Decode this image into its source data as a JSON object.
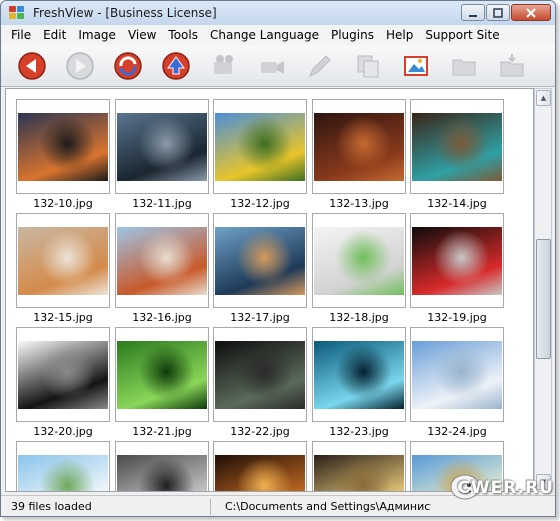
{
  "window": {
    "title": "FreshView - [Business License]"
  },
  "menu": [
    "File",
    "Edit",
    "Image",
    "View",
    "Tools",
    "Change Language",
    "Plugins",
    "Help",
    "Support Site"
  ],
  "toolbar": {
    "buttons": [
      {
        "icon": "back-arrow-icon",
        "enabled": true
      },
      {
        "icon": "forward-arrow-icon",
        "enabled": false
      },
      {
        "icon": "refresh-icon",
        "enabled": true
      },
      {
        "icon": "up-arrow-icon",
        "enabled": true
      },
      {
        "icon": "slideshow-projector-icon",
        "enabled": false
      },
      {
        "icon": "video-camera-icon",
        "enabled": false
      },
      {
        "icon": "pen-edit-icon",
        "enabled": false
      },
      {
        "icon": "copy-files-icon",
        "enabled": false
      },
      {
        "icon": "image-edit-icon",
        "enabled": true
      },
      {
        "icon": "folder-icon",
        "enabled": false
      },
      {
        "icon": "save-folder-icon",
        "enabled": false
      }
    ]
  },
  "thumbnails": [
    {
      "label": "132-10.jpg",
      "colors": [
        "#2b3552",
        "#d9742e",
        "#1b1b1b"
      ]
    },
    {
      "label": "132-11.jpg",
      "colors": [
        "#5a7590",
        "#1a2630",
        "#8a9aa8"
      ]
    },
    {
      "label": "132-12.jpg",
      "colors": [
        "#4d8fd6",
        "#e8c52a",
        "#3d6e22"
      ]
    },
    {
      "label": "132-13.jpg",
      "colors": [
        "#2d1410",
        "#8a3a1c",
        "#c66a30"
      ]
    },
    {
      "label": "132-14.jpg",
      "colors": [
        "#3a2418",
        "#2fa0a4",
        "#7b5b3a"
      ]
    },
    {
      "label": "132-15.jpg",
      "colors": [
        "#c9b8a2",
        "#d48a4a",
        "#ece4d8"
      ]
    },
    {
      "label": "132-16.jpg",
      "colors": [
        "#9ec4e6",
        "#c85a2a",
        "#e8ddd0"
      ]
    },
    {
      "label": "132-17.jpg",
      "colors": [
        "#6fa2c8",
        "#1e3a58",
        "#d49a5c"
      ]
    },
    {
      "label": "132-18.jpg",
      "colors": [
        "#f4f4f4",
        "#d2d2d2",
        "#6fbf5a"
      ]
    },
    {
      "label": "132-19.jpg",
      "colors": [
        "#0c0c0c",
        "#d82a2a",
        "#c8c8c8"
      ]
    },
    {
      "label": "132-20.jpg",
      "colors": [
        "#fafafa",
        "#141414",
        "#8a8a8a"
      ]
    },
    {
      "label": "132-21.jpg",
      "colors": [
        "#2c7a1e",
        "#8ad65a",
        "#0d3a08"
      ]
    },
    {
      "label": "132-22.jpg",
      "colors": [
        "#0e0e0e",
        "#5a6a5a",
        "#2a2a2a"
      ]
    },
    {
      "label": "132-23.jpg",
      "colors": [
        "#0a5a7a",
        "#7ad6ec",
        "#03202e"
      ]
    },
    {
      "label": "132-24.jpg",
      "colors": [
        "#6a9ed8",
        "#eef2f8",
        "#9ab4cc"
      ]
    },
    {
      "label": "",
      "colors": [
        "#8ac4ec",
        "#f4f8fa",
        "#6ea85a"
      ]
    },
    {
      "label": "",
      "colors": [
        "#4a4a4a",
        "#c8c8c8",
        "#1e1e1e"
      ]
    },
    {
      "label": "",
      "colors": [
        "#1e0e06",
        "#c46a24",
        "#f0b050"
      ]
    },
    {
      "label": "",
      "colors": [
        "#2a2018",
        "#e8c87a",
        "#8a6a3a"
      ]
    },
    {
      "label": "",
      "colors": [
        "#5a9ad8",
        "#eaf2d0",
        "#d2a040"
      ]
    }
  ],
  "status": {
    "files_loaded": "39 files loaded",
    "path": "C:\\Documents and Settings\\Администрато"
  },
  "watermark": "CWER.RU"
}
